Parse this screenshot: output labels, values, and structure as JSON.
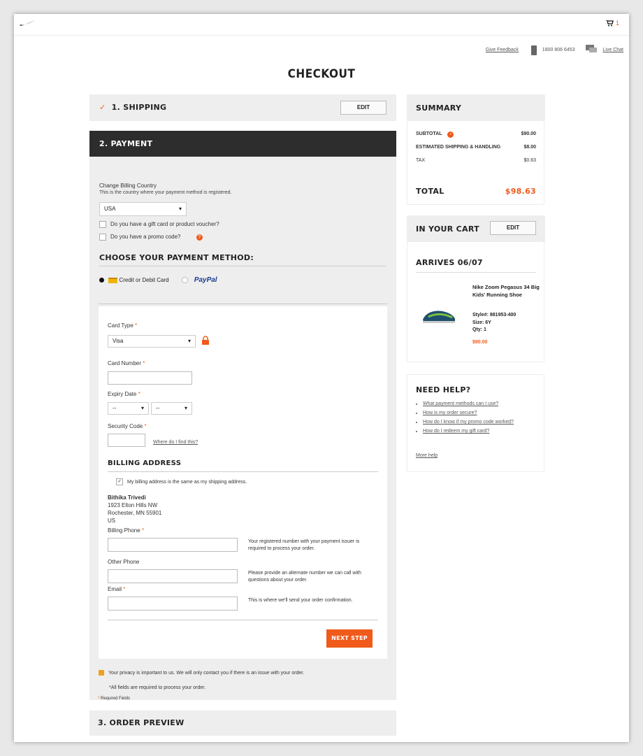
{
  "header": {
    "cart_count": "1",
    "give_feedback": "Give Feedback",
    "phone": "1800 806 6453",
    "live_chat": "Live Chat"
  },
  "page_title": "CHECKOUT",
  "shipping": {
    "title": "1. SHIPPING",
    "edit": "EDIT"
  },
  "payment": {
    "title": "2. PAYMENT",
    "billing_country_label": "Change Billing Country",
    "billing_country_help": "This is the country where your payment method is registered.",
    "country": "USA",
    "gift_card_label": "Do you have a gift card or product voucher?",
    "promo_label": "Do you have a promo code?",
    "choose_method": "CHOOSE YOUR PAYMENT METHOD:",
    "method_card": "Credit or Debit Card",
    "method_paypal": "PayPal",
    "card_type_label": "Card Type",
    "card_type": "Visa",
    "card_number_label": "Card Number",
    "expiry_label": "Expiry Date",
    "expiry_month": "--",
    "expiry_year": "--",
    "security_label": "Security Code",
    "where_find": "Where do I find this?",
    "billing_address_title": "BILLING ADDRESS",
    "same_as_shipping": "My billing address is the same as my shipping address.",
    "address": {
      "name": "Bithika Trivedi",
      "line1": "1923 Elton Hills NW",
      "line2": "Rochester,  MN  55901",
      "country": "US"
    },
    "billing_phone_label": "Billing Phone",
    "billing_phone_help": "Your registered number with your payment issuer is required to process your order.",
    "other_phone_label": "Other Phone",
    "other_phone_help": "Please provide an alternate number we can call with questions about your order.",
    "email_label": "Email",
    "email_help": "This is where we'll send your order confirmation.",
    "next_step": "NEXT STEP",
    "privacy": "Your privacy is important to us. We will only contact you if there is an issue with your order.",
    "all_required": "*All fields are required to process your order.",
    "required_fields": "Required Fields",
    "asterisk": "*"
  },
  "order_preview": {
    "title": "3. ORDER PREVIEW"
  },
  "summary": {
    "title": "SUMMARY",
    "subtotal_label": "SUBTOTAL",
    "subtotal": "$90.00",
    "shipping_label": "ESTIMATED SHIPPING & HANDLING",
    "shipping": "$8.00",
    "tax_label": "TAX",
    "tax": "$0.63",
    "total_label": "TOTAL",
    "total": "$98.63"
  },
  "cart": {
    "title": "IN YOUR CART",
    "edit": "EDIT",
    "arrives": "ARRIVES 06/07",
    "product_name": "Nike Zoom Pegasus 34 Big Kids' Running Shoe",
    "style": "Style#: 881953-400",
    "size": "Size:  6Y",
    "qty": "Qty: 1",
    "price": "$90.00"
  },
  "help": {
    "title": "NEED HELP?",
    "links": [
      "What payment methods can I use?",
      "How is my order secure?",
      "How do I know if my promo code worked?",
      "How do I redeem my gift card?"
    ],
    "more": "More help"
  },
  "colors": {
    "accent": "#f05a1a",
    "dark_header": "#2d2d2d",
    "panel": "#eeeeee"
  }
}
